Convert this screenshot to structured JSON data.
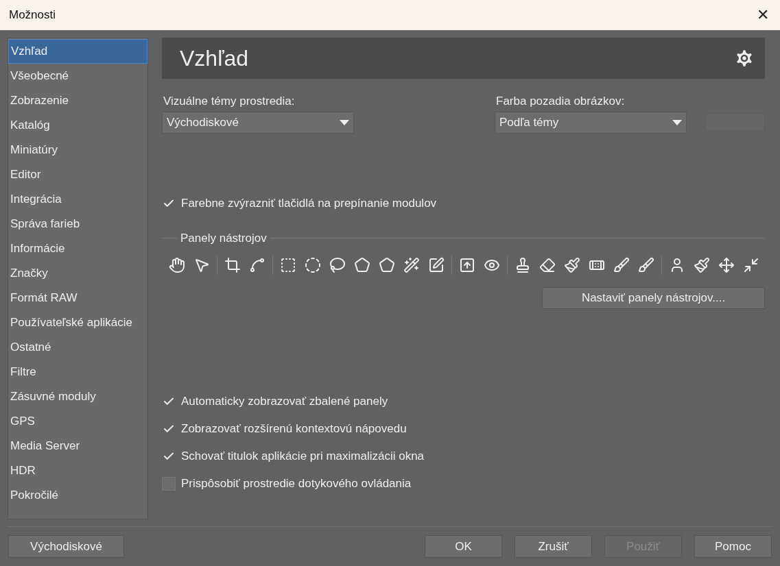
{
  "window": {
    "title": "Možnosti",
    "close": "✕"
  },
  "sidebar": {
    "items": [
      {
        "label": "Vzhľad",
        "selected": true
      },
      {
        "label": "Všeobecné",
        "selected": false
      },
      {
        "label": "Zobrazenie",
        "selected": false
      },
      {
        "label": "Katalóg",
        "selected": false
      },
      {
        "label": "Miniatúry",
        "selected": false
      },
      {
        "label": "Editor",
        "selected": false
      },
      {
        "label": "Integrácia",
        "selected": false
      },
      {
        "label": "Správa farieb",
        "selected": false
      },
      {
        "label": "Informácie",
        "selected": false
      },
      {
        "label": "Značky",
        "selected": false
      },
      {
        "label": "Formát RAW",
        "selected": false
      },
      {
        "label": "Používateľské aplikácie",
        "selected": false
      },
      {
        "label": "Ostatné",
        "selected": false
      },
      {
        "label": "Filtre",
        "selected": false
      },
      {
        "label": "Zásuvné moduly",
        "selected": false
      },
      {
        "label": "GPS",
        "selected": false
      },
      {
        "label": "Media Server",
        "selected": false
      },
      {
        "label": "HDR",
        "selected": false
      },
      {
        "label": "Pokročilé",
        "selected": false
      }
    ]
  },
  "page": {
    "heading": "Vzhľad",
    "theme": {
      "label": "Vizuálne témy prostredia:",
      "value": "Východiskové"
    },
    "background": {
      "label": "Farba pozadia obrázkov:",
      "value": "Podľa témy"
    },
    "highlight_option": {
      "label": "Farebne zvýrazniť tlačidlá na prepínanie modulov",
      "checked": true
    },
    "toolbars": {
      "title": "Panely nástrojov",
      "configure_button": "Nastaviť panely nástrojov...."
    },
    "options": [
      {
        "label": "Automaticky zobrazovať zbalené panely",
        "checked": true
      },
      {
        "label": "Zobrazovať rozšírenú kontextovú nápovedu",
        "checked": true
      },
      {
        "label": "Schovať titulok aplikácie pri maximalizácii okna",
        "checked": true
      },
      {
        "label": "Prispôsobiť prostredie dotykového ovládania",
        "checked": false
      }
    ]
  },
  "footer": {
    "defaults_button": "Východiskové",
    "buttons": [
      {
        "label": "OK",
        "disabled": false
      },
      {
        "label": "Zrušiť",
        "disabled": false
      },
      {
        "label": "Použiť",
        "disabled": true
      },
      {
        "label": "Pomoc",
        "disabled": false
      }
    ]
  }
}
